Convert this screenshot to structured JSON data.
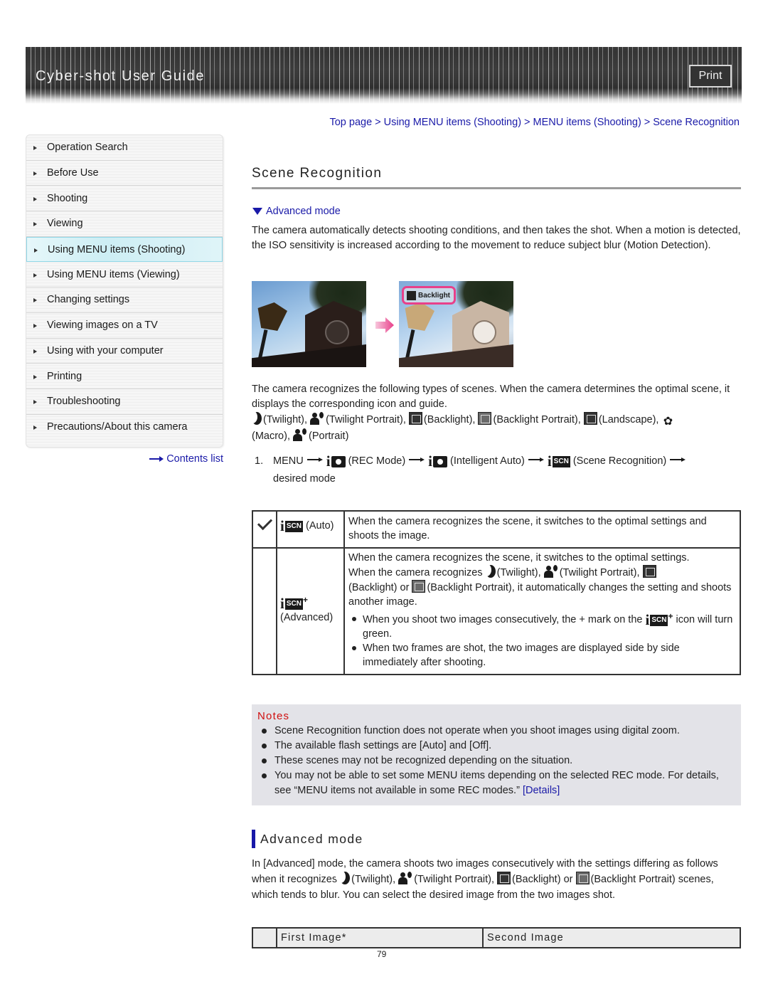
{
  "header": {
    "title": "Cyber-shot User Guide",
    "print_label": "Print"
  },
  "sidebar": {
    "items": [
      {
        "label": "Operation Search",
        "active": false
      },
      {
        "label": "Before Use",
        "active": false
      },
      {
        "label": "Shooting",
        "active": false
      },
      {
        "label": "Viewing",
        "active": false
      },
      {
        "label": "Using MENU items (Shooting)",
        "active": true
      },
      {
        "label": "Using MENU items (Viewing)",
        "active": false
      },
      {
        "label": "Changing settings",
        "active": false
      },
      {
        "label": "Viewing images on a TV",
        "active": false
      },
      {
        "label": "Using with your computer",
        "active": false
      },
      {
        "label": "Printing",
        "active": false
      },
      {
        "label": "Troubleshooting",
        "active": false
      },
      {
        "label": "Precautions/About this camera",
        "active": false
      }
    ],
    "contents_link": "Contents list"
  },
  "breadcrumb": {
    "items": [
      "Top page",
      "Using MENU items (Shooting)",
      "MENU items (Shooting)",
      "Scene Recognition"
    ],
    "separator": ">"
  },
  "main": {
    "title": "Scene Recognition",
    "advanced_link": "Advanced mode",
    "intro": "The camera automatically detects shooting conditions, and then takes the shot. When a motion is detected, the ISO sensitivity is increased according to the movement to reduce subject blur (Motion Detection).",
    "photo_badge": "Backlight",
    "scenes_intro": "The camera recognizes the following types of scenes. When the camera determines the optimal scene, it displays the corresponding icon and guide.",
    "scene_types": {
      "twilight": "(Twilight),",
      "twilight_portrait": "(Twilight Portrait),",
      "backlight": "(Backlight),",
      "backlight_portrait": "(Backlight Portrait),",
      "landscape": "(Landscape),",
      "macro": "(Macro),",
      "portrait": "(Portrait)"
    },
    "step": {
      "number": "1.",
      "menu": "MENU",
      "rec_mode": "(REC Mode)",
      "intelligent_auto": "(Intelligent Auto)",
      "scene_recognition": "(Scene Recognition)",
      "desired": "desired mode",
      "scn_text": "SCN"
    },
    "modes_table": {
      "auto": {
        "label": "(Auto)",
        "desc": "When the camera recognizes the scene, it switches to the optimal settings and shoots the image."
      },
      "advanced": {
        "label": "(Advanced)",
        "desc_1": "When the camera recognizes the scene, it switches to the optimal settings.",
        "desc_2a": "When the camera recognizes",
        "desc_2b": "(Twilight),",
        "desc_2c": "(Twilight Portrait),",
        "desc_2d": "(Backlight) or",
        "desc_2e": "(Backlight Portrait), it automatically changes the setting and shoots another image.",
        "bullet_1a": "When you shoot two images consecutively, the + mark on the",
        "bullet_1b": "icon will turn green.",
        "bullet_2": "When two frames are shot, the two images are displayed side by side immediately after shooting."
      }
    },
    "notes": {
      "title": "Notes",
      "items": [
        "Scene Recognition function does not operate when you shoot images using digital zoom.",
        "The available flash settings are [Auto] and [Off].",
        "These scenes may not be recognized depending on the situation.",
        "You may not be able to set some MENU items depending on the selected REC mode. For details, see “MENU items not available in some REC modes.”"
      ],
      "details_link": "[Details]"
    },
    "advanced_section": {
      "title": "Advanced mode",
      "text_1": "In [Advanced] mode, the camera shoots two images consecutively with the settings differing as follows when it recognizes",
      "twilight": "(Twilight),",
      "twilight_portrait": "(Twilight Portrait),",
      "backlight": "(Backlight) or",
      "text_2": "(Backlight Portrait) scenes, which tends to blur. You can select the desired image from the two images shot."
    },
    "images_table": {
      "col_1": "First Image*",
      "col_2": "Second Image"
    }
  },
  "footer": {
    "page_number": "79"
  },
  "colors": {
    "link": "#1a1aa8",
    "notes_title": "#d01010",
    "notes_bg": "#e3e3e8",
    "badge_border": "#e8408a",
    "section_bar": "#1818a8"
  }
}
